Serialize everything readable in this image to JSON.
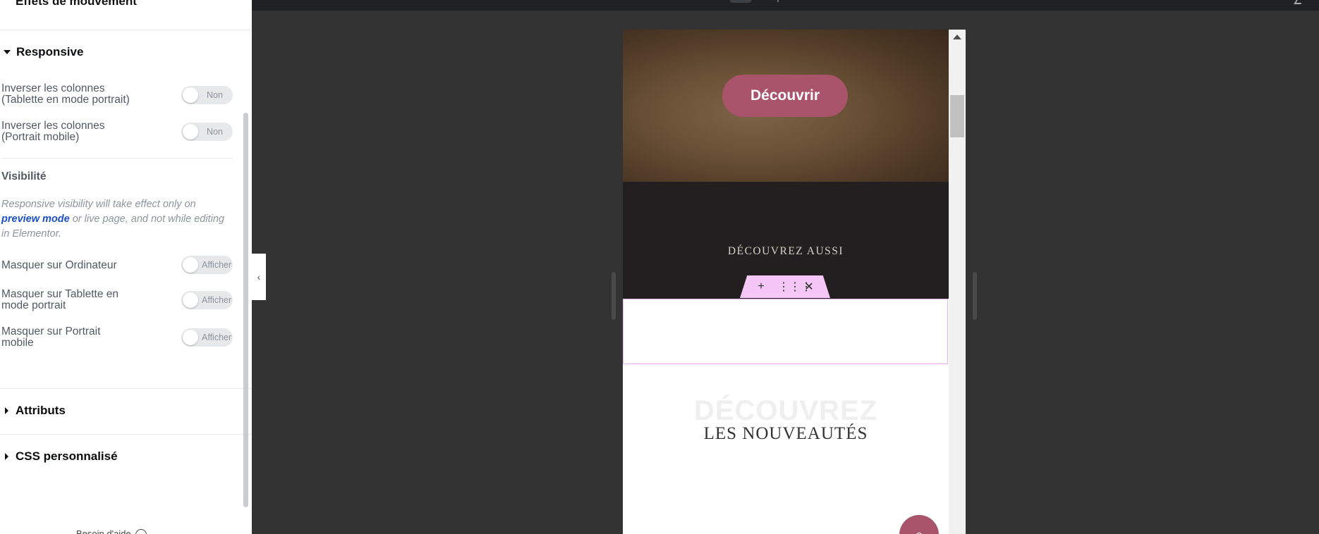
{
  "panel": {
    "cut_title": "Effets de mouvement",
    "responsive": {
      "title": "Responsive",
      "reverse_tablet": {
        "label_line1": "Inverser les colonnes",
        "label_line2": "(Tablette en mode portrait)",
        "state": "Non"
      },
      "reverse_mobile": {
        "label_line1": "Inverser les colonnes",
        "label_line2": "(Portrait mobile)",
        "state": "Non"
      },
      "visibility_heading": "Visibilité",
      "note_before": "Responsive visibility will take effect only on ",
      "note_link": "preview mode",
      "note_after": " or live page, and not while editing in Elementor.",
      "hide_desktop": {
        "label_line1": "Masquer sur Ordinateur",
        "label_line2": "",
        "state": "Afficher"
      },
      "hide_tablet": {
        "label_line1": "Masquer sur Tablette en",
        "label_line2": "mode portrait",
        "state": "Afficher"
      },
      "hide_mobile": {
        "label_line1": "Masquer sur Portrait",
        "label_line2": "mobile",
        "state": "Afficher"
      }
    },
    "attributes_title": "Attributs",
    "custom_css_title": "CSS personnalisé",
    "help_text": "Besoin d'aide"
  },
  "collapse_icon": "chevron-left-icon",
  "preview": {
    "hero_button": "Découvrir",
    "also_heading": "DÉCOUVREZ AUSSI",
    "toolbar": {
      "add": "+",
      "drag": "⋮⋮⋮",
      "close": "✕"
    },
    "news_ghost": "DÉCOUVREZ",
    "news_title": "LES NOUVEAUTÉS",
    "fab_icon": "chevron-up-icon",
    "colors": {
      "accent": "#a9546a",
      "toolbar": "#f5c7f7",
      "dark_band": "#231f20"
    }
  }
}
